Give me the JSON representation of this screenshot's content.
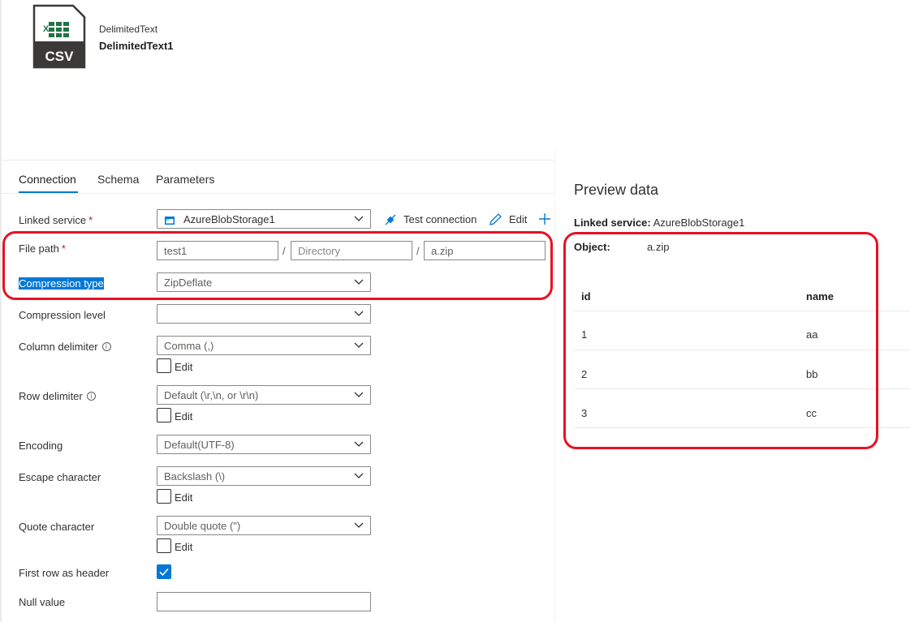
{
  "dataset": {
    "icon": "csv-file-icon",
    "icon_text": "CSV",
    "type": "DelimitedText",
    "name": "DelimitedText1"
  },
  "tabs": [
    {
      "label": "Connection",
      "active": true
    },
    {
      "label": "Schema",
      "active": false
    },
    {
      "label": "Parameters",
      "active": false
    }
  ],
  "form": {
    "linked_service": {
      "label": "Linked service",
      "required_mark": "*",
      "value": "AzureBlobStorage1",
      "test_connection": "Test connection",
      "edit": "Edit"
    },
    "file_path": {
      "label": "File path",
      "required_mark": "*",
      "container": "test1",
      "directory_placeholder": "Directory",
      "file": "a.zip",
      "separator": "/"
    },
    "compression_type": {
      "label": "Compression type",
      "value": "ZipDeflate"
    },
    "compression_level": {
      "label": "Compression level",
      "value": ""
    },
    "column_delimiter": {
      "label": "Column delimiter",
      "value": "Comma (,)",
      "edit": "Edit",
      "edit_checked": false
    },
    "row_delimiter": {
      "label": "Row delimiter",
      "value": "Default (\\r,\\n, or \\r\\n)",
      "edit": "Edit",
      "edit_checked": false
    },
    "encoding": {
      "label": "Encoding",
      "value": "Default(UTF-8)"
    },
    "escape_character": {
      "label": "Escape character",
      "value": "Backslash (\\)",
      "edit": "Edit",
      "edit_checked": false
    },
    "quote_character": {
      "label": "Quote character",
      "value": "Double quote (\")",
      "edit": "Edit",
      "edit_checked": false
    },
    "first_row_header": {
      "label": "First row as header",
      "checked": true
    },
    "null_value": {
      "label": "Null value",
      "value": ""
    }
  },
  "preview": {
    "title": "Preview data",
    "linked_service_label": "Linked service:",
    "linked_service_value": "AzureBlobStorage1",
    "object_label": "Object:",
    "object_value": "a.zip",
    "columns": [
      "id",
      "name"
    ],
    "rows": [
      [
        "1",
        "aa"
      ],
      [
        "2",
        "bb"
      ],
      [
        "3",
        "cc"
      ]
    ]
  },
  "colors": {
    "accent": "#0078d4",
    "highlight_red": "#e81123",
    "excel_green": "#217346"
  }
}
